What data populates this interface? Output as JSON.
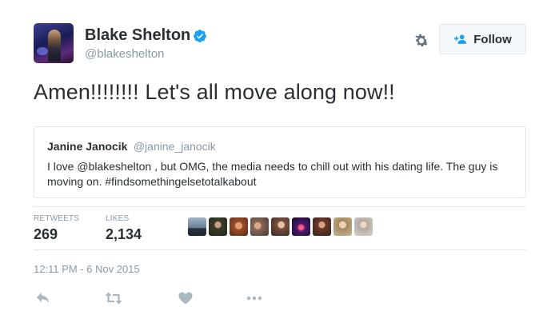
{
  "tweet": {
    "author": {
      "name": "Blake Shelton",
      "handle": "@blakeshelton",
      "verified": true
    },
    "follow_label": "Follow",
    "text": "Amen!!!!!!!! Let's all move along now!!",
    "quoted": {
      "name": "Janine Janocik",
      "handle": "@janine_janocik",
      "text": "I love @blakeshelton , but OMG, the media needs to chill out with his dating life. The guy is moving on. #findsomethingelsetotalkabout"
    },
    "stats": {
      "retweets_label": "RETWEETS",
      "retweets_value": "269",
      "likes_label": "LIKES",
      "likes_value": "2,134"
    },
    "timestamp": "12:11 PM - 6 Nov 2015"
  },
  "icons": {
    "settings": "gear-icon",
    "follow": "add-person-icon",
    "verified": "verified-badge-icon",
    "reply": "reply-icon",
    "retweet": "retweet-icon",
    "like": "heart-icon",
    "more": "more-icon"
  },
  "colors": {
    "text": "#292f33",
    "secondary": "#8899a6",
    "border": "#e1e8ed",
    "verified": "#1da1f2",
    "follow_icon": "#1da1f2"
  }
}
